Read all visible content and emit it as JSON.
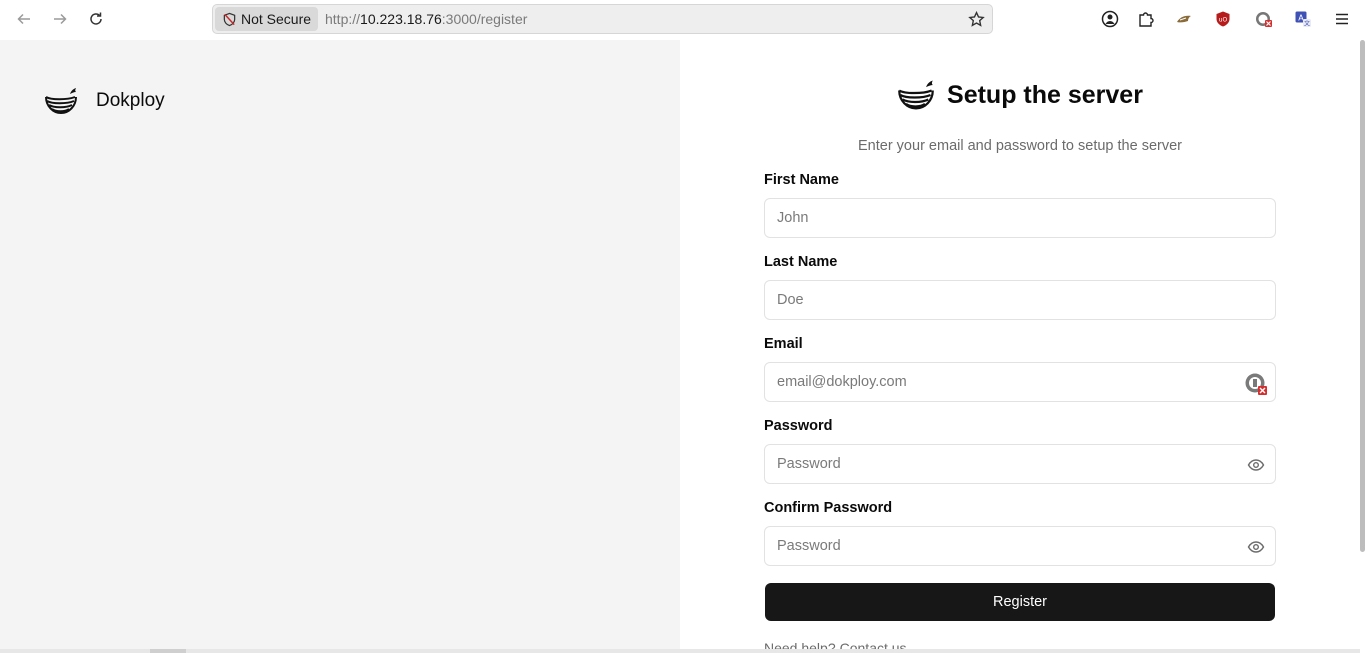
{
  "browser": {
    "security_label": "Not Secure",
    "url_scheme": "http://",
    "url_host": "10.223.18.76",
    "url_rest": ":3000/register"
  },
  "brand": {
    "name": "Dokploy",
    "logo_icon": "dokploy-whale-logo"
  },
  "form": {
    "title": "Setup the server",
    "subtitle": "Enter your email and password to setup the server",
    "first_name": {
      "label": "First Name",
      "placeholder": "John",
      "value": ""
    },
    "last_name": {
      "label": "Last Name",
      "placeholder": "Doe",
      "value": ""
    },
    "email": {
      "label": "Email",
      "placeholder": "email@dokploy.com",
      "value": ""
    },
    "password": {
      "label": "Password",
      "placeholder": "Password",
      "value": ""
    },
    "confirm_password": {
      "label": "Confirm Password",
      "placeholder": "Password",
      "value": ""
    },
    "submit_label": "Register",
    "help_text": "Need help?",
    "help_link": "Contact us"
  },
  "colors": {
    "left_bg": "#f4f4f5",
    "button_bg": "#171717",
    "muted_text": "#6b6b6b"
  }
}
